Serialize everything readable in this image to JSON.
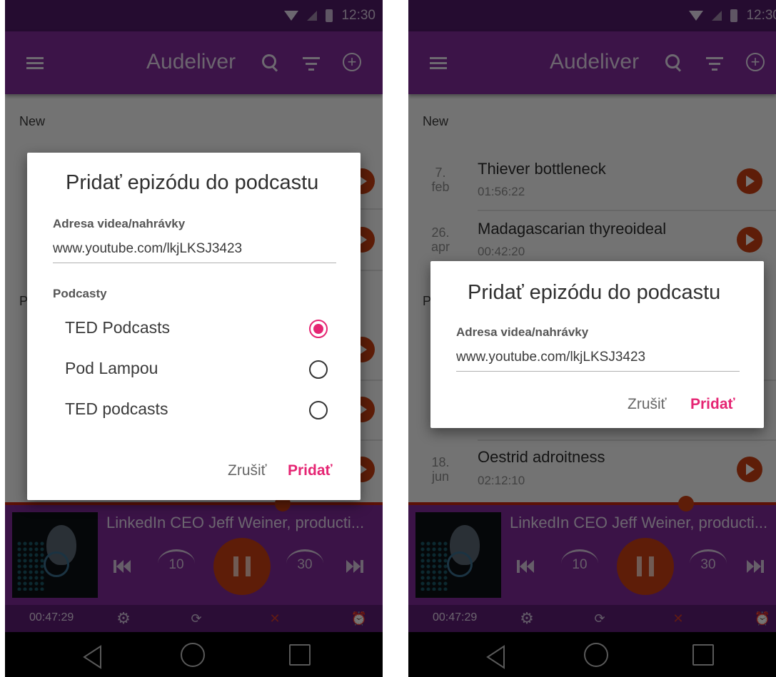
{
  "status_bar": {
    "time": "12:30"
  },
  "app_bar": {
    "title": "Audeliver"
  },
  "icons": {
    "menu": "menu-icon",
    "search": "search-icon",
    "filter": "filter-icon",
    "add": "add-circle-icon"
  },
  "colors": {
    "primary": "#7f2c9a",
    "status_bar": "#4f1a66",
    "accent": "#e52573",
    "play": "#c83e12"
  },
  "section_new": "New",
  "section_podcasts_partial": "P",
  "episodes": [
    {
      "date_day": "7.",
      "date_month": "feb",
      "title": "Thiever bottleneck",
      "duration": "01:56:22"
    },
    {
      "date_day": "26.",
      "date_month": "apr",
      "title": "Madagascarian thyreoideal",
      "duration": "00:42:20"
    },
    {
      "date_day": "18.",
      "date_month": "jun",
      "title": "Oestrid adroitness",
      "duration": "02:12:10"
    }
  ],
  "dialog": {
    "title": "Pridať epizódu do podcastu",
    "url_label": "Adresa videa/nahrávky",
    "url_value": "www.youtube.com/lkjLKSJ3423",
    "podcasts_label": "Podcasty",
    "podcasts": [
      {
        "name": "TED Podcasts",
        "selected": true
      },
      {
        "name": "Pod Lampou",
        "selected": false
      },
      {
        "name": "TED podcasts",
        "selected": false
      }
    ],
    "cancel": "Zrušiť",
    "add": "Pridať"
  },
  "player": {
    "title": "LinkedIn CEO Jeff Weiner, producti...",
    "rewind_seconds": "10",
    "forward_seconds": "30",
    "elapsed": "00:47:29"
  },
  "player_controls": {
    "settings": "gear-icon",
    "repeat": "repeat-icon",
    "shuffle": "shuffle-icon",
    "sleep_timer": "alarm-icon"
  }
}
